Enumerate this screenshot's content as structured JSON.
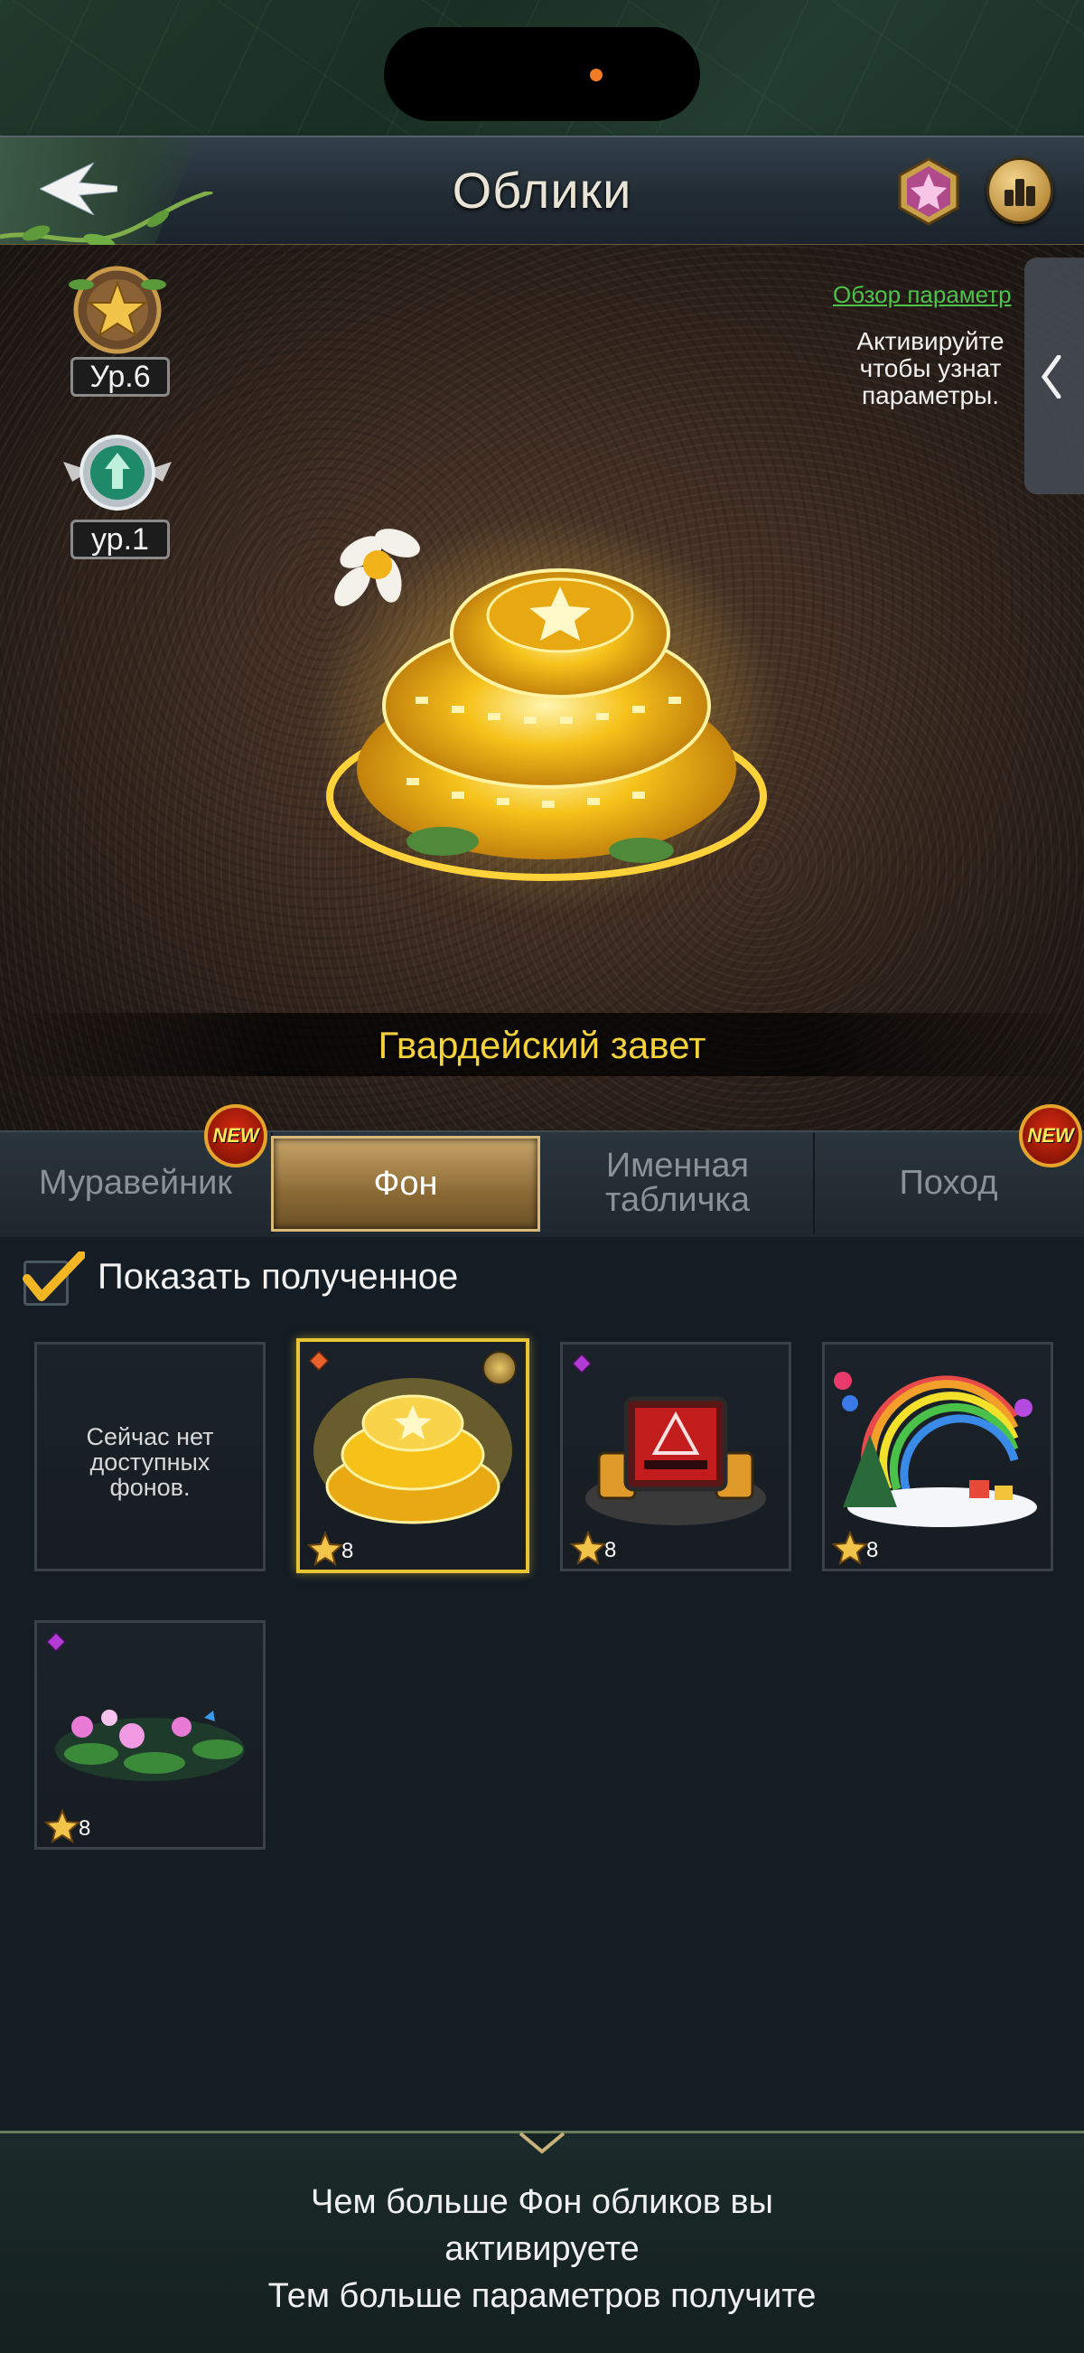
{
  "header": {
    "title": "Облики"
  },
  "levels": [
    {
      "label": "Ур.6",
      "icon": "star-medal-icon"
    },
    {
      "label": "ур.1",
      "icon": "green-crest-medal-icon"
    }
  ],
  "info": {
    "overview_link": "Обзор параметр",
    "activate_text": "Активируйте\nчтобы узнат\nпараметры."
  },
  "preview": {
    "skin_name": "Гвардейский завет"
  },
  "tabs": [
    {
      "label": "Муравейник",
      "new": true,
      "active": false
    },
    {
      "label": "Фон",
      "new": false,
      "active": true
    },
    {
      "label": "Именная\nтабличка",
      "new": false,
      "active": false
    },
    {
      "label": "Поход",
      "new": true,
      "active": false
    }
  ],
  "new_badge_label": "NEW",
  "filter": {
    "show_obtained_label": "Показать полученное",
    "checked": true
  },
  "grid": {
    "empty_text": "Сейчас нет\nдоступных\nфонов.",
    "items": [
      {
        "name": "Гвардейский завет",
        "stars": "8",
        "rarity": "orange",
        "selected": true
      },
      {
        "name": "energy-warning-base",
        "stars": "8",
        "rarity": "purple",
        "selected": false
      },
      {
        "name": "rainbow-christmas",
        "stars": "8",
        "rarity": "none",
        "selected": false
      },
      {
        "name": "lotus-pond",
        "stars": "8",
        "rarity": "purple",
        "selected": false
      }
    ]
  },
  "footer": {
    "text": "Чем больше Фон обликов вы\nактивируете\nТем больше параметров получите"
  },
  "colors": {
    "accent_gold": "#e8c534",
    "skin_name": "#f5d23a",
    "link_green": "#4ec24a",
    "new_badge": "#d62a12"
  }
}
